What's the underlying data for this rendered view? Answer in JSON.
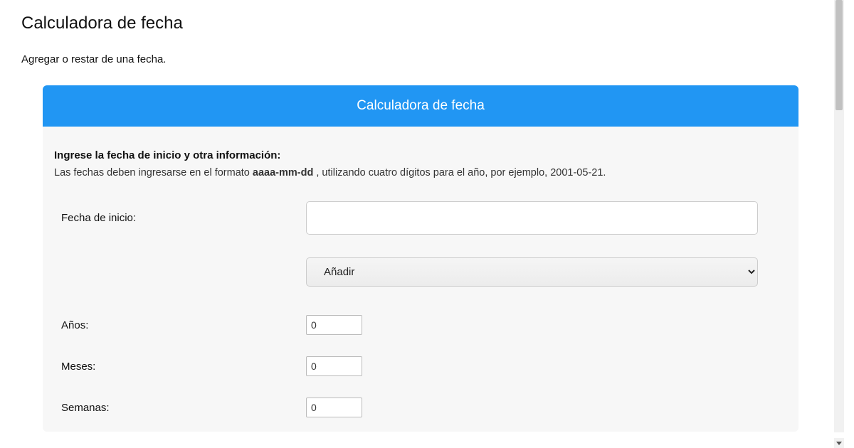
{
  "page": {
    "title": "Calculadora de fecha",
    "subtitle": "Agregar o restar de una fecha."
  },
  "panel": {
    "header": "Calculadora de fecha",
    "instruction_title": "Ingrese la fecha de inicio y otra información:",
    "instruction_prefix": "Las fechas deben ingresarse en el formato ",
    "instruction_format": "aaaa-mm-dd",
    "instruction_suffix": " , utilizando cuatro dígitos para el año, por ejemplo, 2001-05-21."
  },
  "form": {
    "start_label": "Fecha de inicio:",
    "start_value": "",
    "operation_selected": "Añadir",
    "years_label": "Años:",
    "years_value": "0",
    "months_label": "Meses:",
    "months_value": "0",
    "weeks_label": "Semanas:",
    "weeks_value": "0"
  }
}
